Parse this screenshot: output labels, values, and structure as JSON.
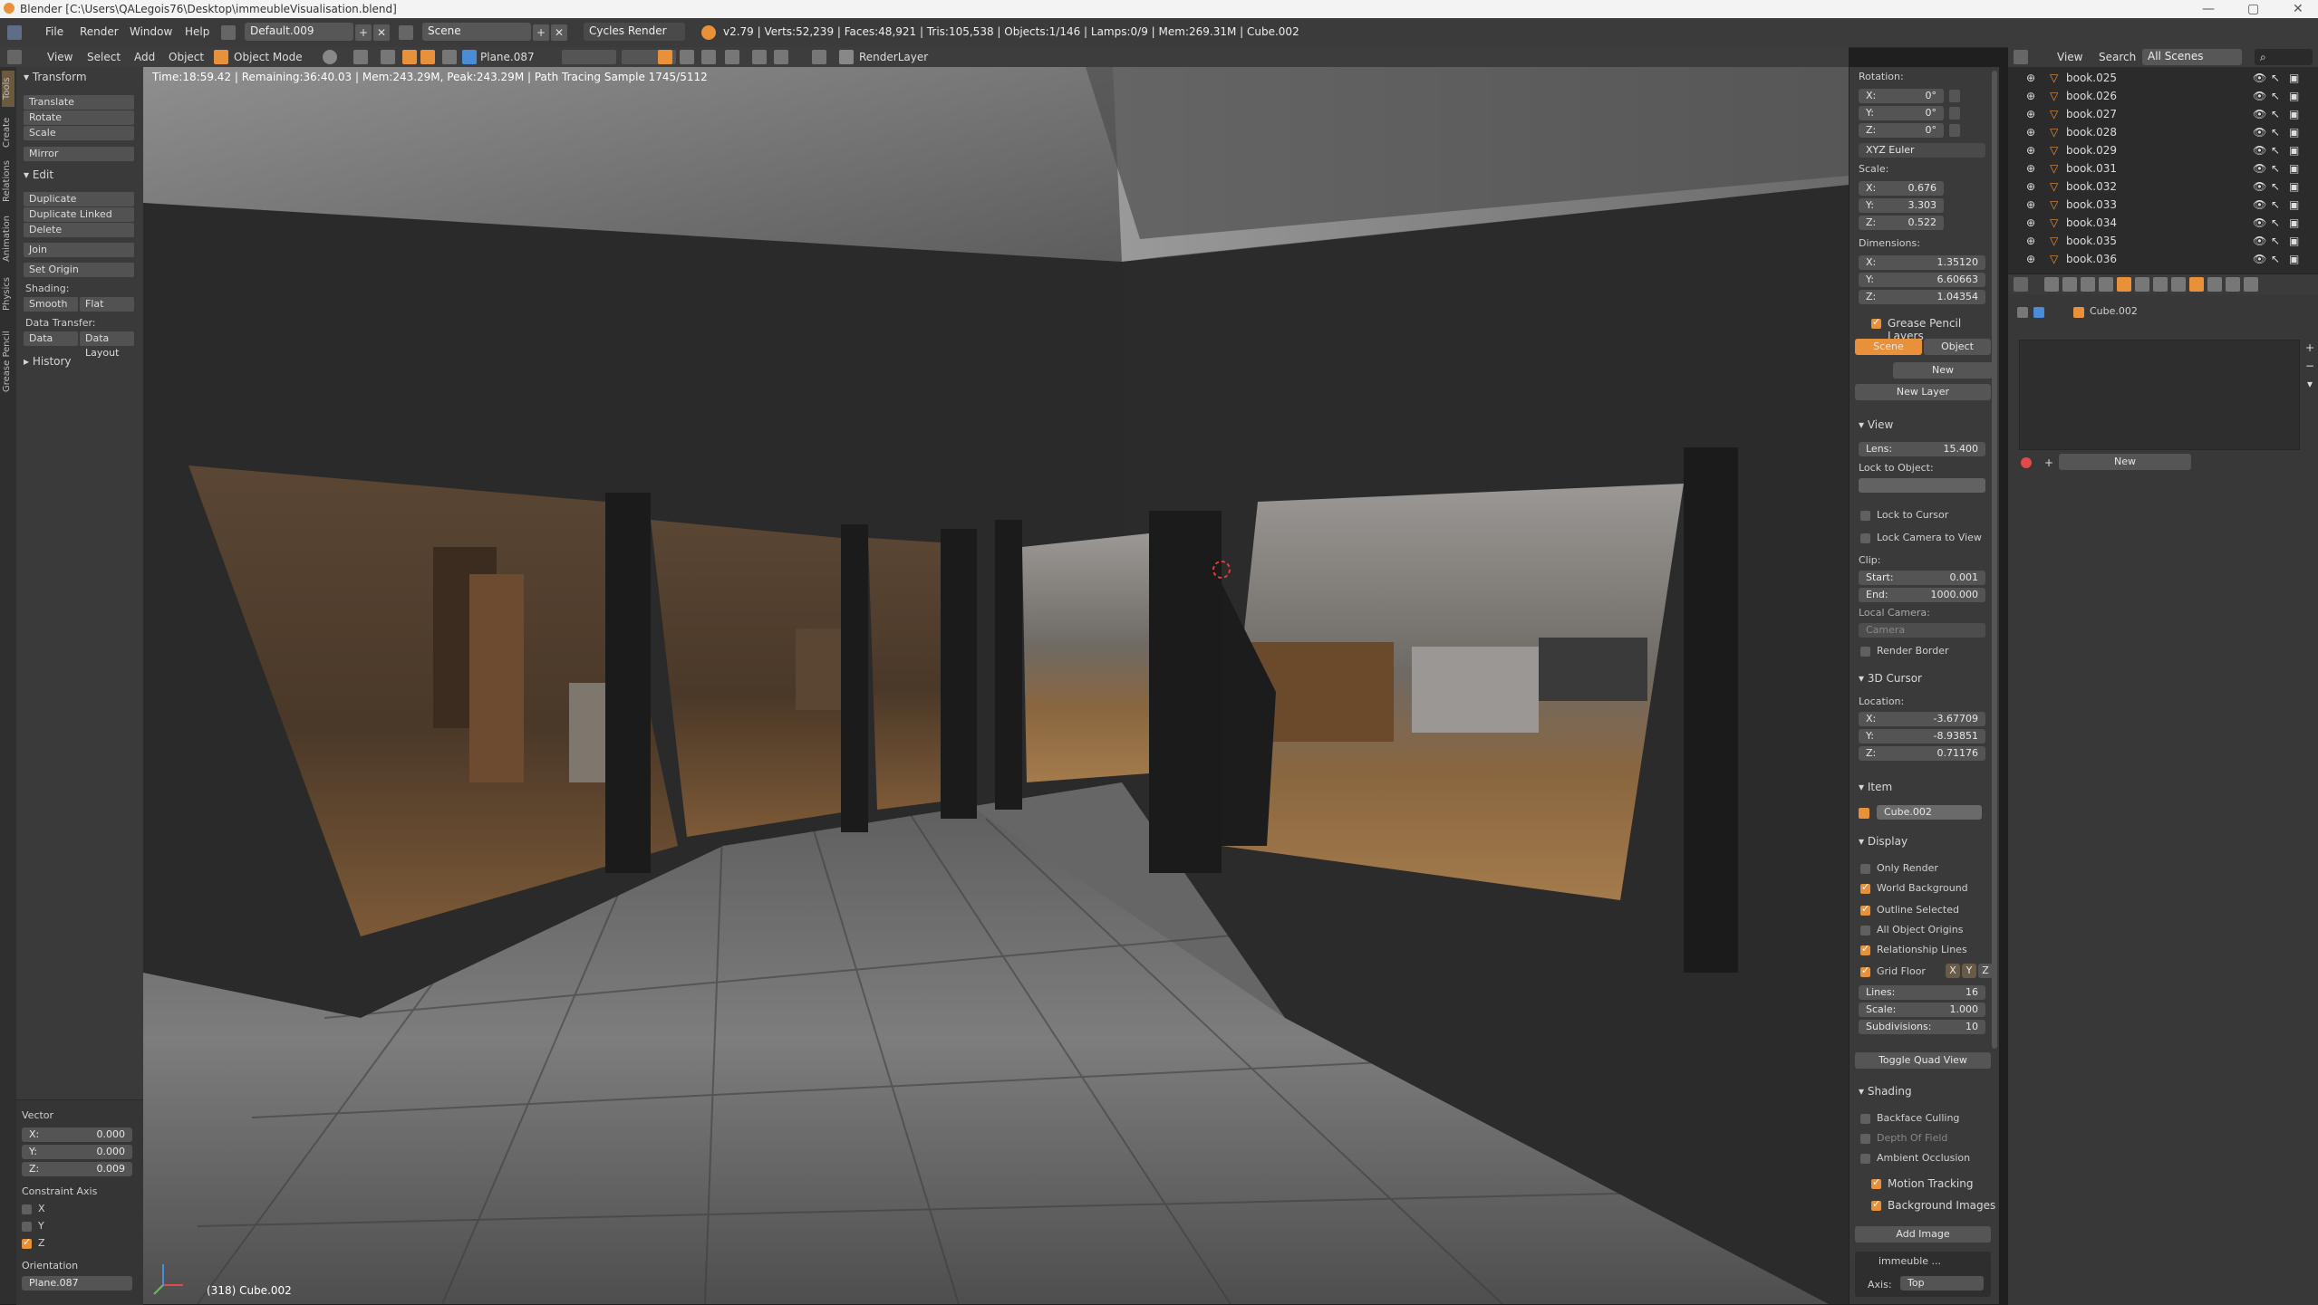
{
  "window": {
    "title": "Blender [C:\\Users\\QALegois76\\Desktop\\immeubleVisualisation.blend]",
    "minimize": "—",
    "maximize": "▢",
    "close": "✕"
  },
  "info_header": {
    "menus": [
      "File",
      "Render",
      "Window",
      "Help"
    ],
    "screen_layout": "Default.009",
    "scene": "Scene",
    "render_engine": "Cycles Render",
    "stats": "v2.79 | Verts:52,239 | Faces:48,921 | Tris:105,538 | Objects:1/146 | Lamps:0/9 | Mem:269.31M | Cube.002"
  },
  "viewport_header": {
    "menus": [
      "View",
      "Select",
      "Add",
      "Object"
    ],
    "mode": "Object Mode",
    "pivot_object": "Plane.087",
    "render_layer": "RenderLayer"
  },
  "tool_tabs": [
    "Tools",
    "Create",
    "Relations",
    "Animation",
    "Physics",
    "Grease Pencil"
  ],
  "tool_shelf": {
    "transform_title": "Transform",
    "transform_buttons": [
      "Translate",
      "Rotate",
      "Scale",
      "Mirror"
    ],
    "edit_title": "Edit",
    "edit_buttons": [
      "Duplicate",
      "Duplicate Linked",
      "Delete",
      "Join",
      "Set Origin"
    ],
    "shading_label": "Shading:",
    "shading_smooth": "Smooth",
    "shading_flat": "Flat",
    "data_transfer_label": "Data Transfer:",
    "data_transfer_data": "Data",
    "data_transfer_layout": "Data Layout",
    "history_title": "History"
  },
  "operator_panel": {
    "vector_title": "Vector",
    "x_label": "X:",
    "x_value": "0.000",
    "y_label": "Y:",
    "y_value": "0.000",
    "z_label": "Z:",
    "z_value": "0.009",
    "constraint_title": "Constraint Axis",
    "constraint_x": "X",
    "constraint_y": "Y",
    "constraint_z": "Z",
    "constraint_z_checked": true,
    "orientation_title": "Orientation",
    "orientation_value": "Plane.087"
  },
  "viewport": {
    "status_text": "Time:18:59.42 | Remaining:36:40.03 | Mem:243.29M, Peak:243.29M | Path Tracing Sample 1745/5112",
    "footer_text": "(318) Cube.002"
  },
  "properties_panel": {
    "rotation_label": "Rotation:",
    "rot_x": "0°",
    "rot_y": "0°",
    "rot_z": "0°",
    "rotation_mode": "XYZ Euler",
    "scale_label": "Scale:",
    "scale_x": "0.676",
    "scale_y": "3.303",
    "scale_z": "0.522",
    "dimensions_label": "Dimensions:",
    "dim_x": "1.35120",
    "dim_y": "6.60663",
    "dim_z": "1.04354",
    "gp_layers_title": "Grease Pencil Layers",
    "gp_scene": "Scene",
    "gp_object": "Object",
    "gp_new": "New",
    "gp_new_layer": "New Layer",
    "view_title": "View",
    "lens_label": "Lens:",
    "lens_value": "15.400",
    "lock_to_object": "Lock to Object:",
    "lock_to_cursor": "Lock to Cursor",
    "lock_camera_to_view": "Lock Camera to View",
    "clip_label": "Clip:",
    "clip_start_label": "Start:",
    "clip_start": "0.001",
    "clip_end_label": "End:",
    "clip_end": "1000.000",
    "local_camera": "Local Camera:",
    "camera_field": "Camera",
    "render_border": "Render Border",
    "cursor_title": "3D Cursor",
    "location_label": "Location:",
    "cur_x": "-3.67709",
    "cur_y": "-8.93851",
    "cur_z": "0.71176",
    "item_title": "Item",
    "item_name": "Cube.002",
    "display_title": "Display",
    "only_render": "Only Render",
    "world_background": "World Background",
    "outline_selected": "Outline Selected",
    "all_object_origins": "All Object Origins",
    "relationship_lines": "Relationship Lines",
    "grid_floor": "Grid Floor",
    "axis_x": "X",
    "axis_y": "Y",
    "axis_z": "Z",
    "lines_label": "Lines:",
    "lines_value": "16",
    "scale_label2": "Scale:",
    "scale_value": "1.000",
    "subdiv_label": "Subdivisions:",
    "subdiv_value": "10",
    "toggle_quad_view": "Toggle Quad View",
    "shading_title": "Shading",
    "backface_culling": "Backface Culling",
    "depth_of_field": "Depth Of Field",
    "ambient_occlusion": "Ambient Occlusion",
    "motion_tracking": "Motion Tracking",
    "background_images": "Background Images",
    "add_image": "Add Image",
    "bg_image_name": "immeuble ...",
    "axis_label": "Axis:",
    "axis_value": "Top"
  },
  "outliner": {
    "menu_view": "View",
    "menu_search": "Search",
    "scenes_filter": "All Scenes",
    "items": [
      "book.025",
      "book.026",
      "book.027",
      "book.028",
      "book.029",
      "book.031",
      "book.032",
      "book.033",
      "book.034",
      "book.035",
      "book.036"
    ]
  },
  "property_editor": {
    "breadcrumb": "Cube.002",
    "new_button": "New"
  },
  "colors": {
    "accent": "#e8913a",
    "header": "#3b3b3b",
    "panel": "#3a3a3a",
    "outliner": "#2b2b2b"
  }
}
